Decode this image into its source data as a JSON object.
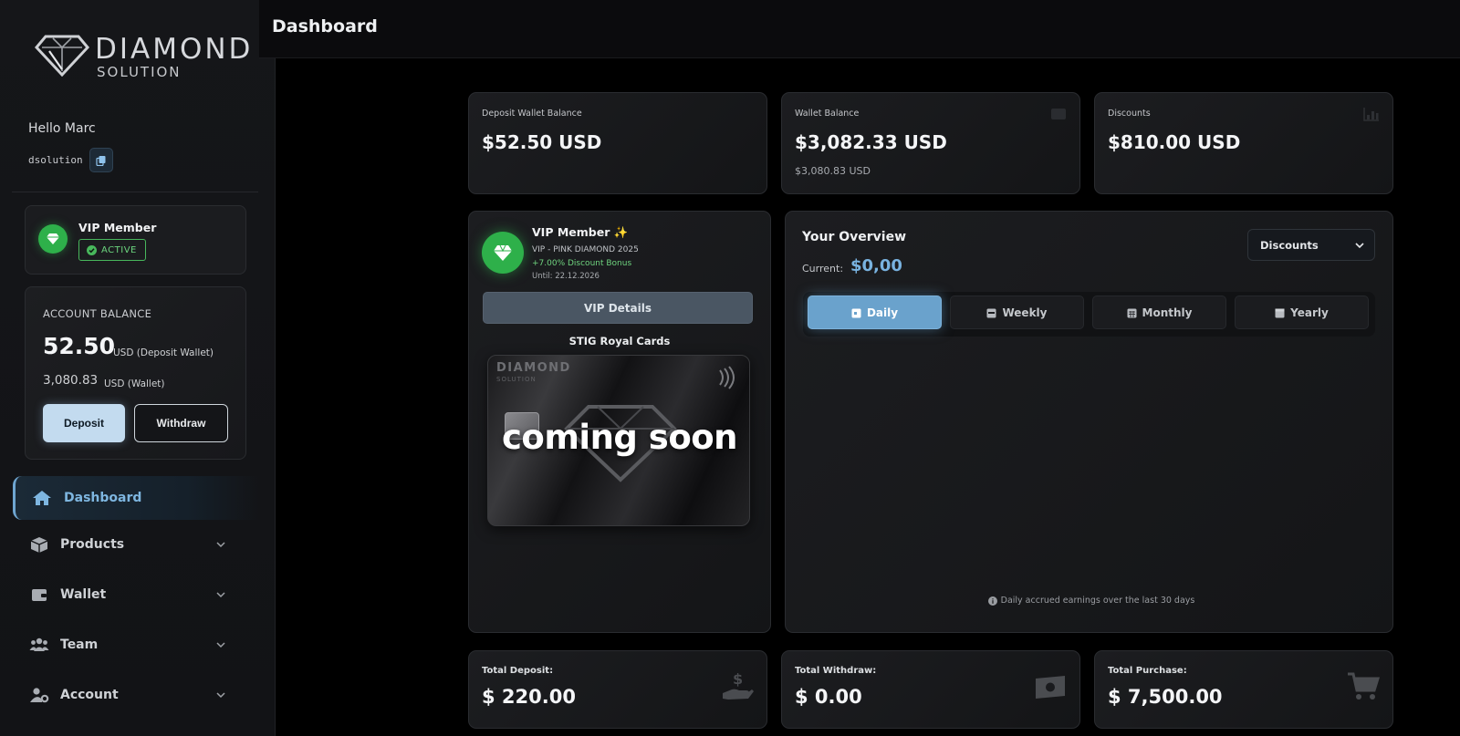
{
  "sidebar": {
    "logo": {
      "line1": "DIAMOND",
      "line2": "SOLUTION"
    },
    "greeting": "Hello Marc",
    "username": "dsolution",
    "vip": {
      "title": "VIP Member",
      "status": "ACTIVE"
    },
    "balance": {
      "label": "ACCOUNT BALANCE",
      "main_value": "52.50",
      "main_unit": "USD (Deposit Wallet)",
      "sub_value": "3,080.83",
      "sub_unit": "USD (Wallet)",
      "deposit_label": "Deposit",
      "withdraw_label": "Withdraw"
    },
    "nav": [
      {
        "label": "Dashboard",
        "icon": "home-icon"
      },
      {
        "label": "Products",
        "icon": "box-icon"
      },
      {
        "label": "Wallet",
        "icon": "wallet-icon"
      },
      {
        "label": "Team",
        "icon": "team-icon"
      },
      {
        "label": "Account",
        "icon": "user-gear-icon"
      }
    ]
  },
  "header": {
    "title": "Dashboard"
  },
  "stats": [
    {
      "label": "Deposit Wallet Balance",
      "value": "$52.50 USD",
      "sub": ""
    },
    {
      "label": "Wallet Balance",
      "value": "$3,082.33 USD",
      "sub": "$3,080.83 USD"
    },
    {
      "label": "Discounts",
      "value": "$810.00 USD",
      "sub": ""
    }
  ],
  "vip_card": {
    "title": "VIP Member",
    "tier": "VIP - PINK DIAMOND 2025",
    "bonus": "+7.00% Discount Bonus",
    "until": "Until: 22.12.2026",
    "details_label": "VIP Details",
    "cards_title": "STIG Royal Cards",
    "card_brand": "DIAMOND",
    "card_brand_sub": "SOLUTION",
    "card_overlay": "coming soon"
  },
  "overview": {
    "title": "Your Overview",
    "current_label": "Current:",
    "current_value": "$0,00",
    "select_value": "Discounts",
    "tabs": [
      "Daily",
      "Weekly",
      "Monthly",
      "Yearly"
    ],
    "note": "Daily accrued earnings over the last 30 days"
  },
  "totals": [
    {
      "label": "Total Deposit:",
      "value": "$ 220.00"
    },
    {
      "label": "Total Withdraw:",
      "value": "$ 0.00"
    },
    {
      "label": "Total Purchase:",
      "value": "$ 7,500.00"
    }
  ],
  "colors": {
    "accent": "#6aa2cc",
    "vip_green": "#2eb04a",
    "background": "#000000"
  }
}
